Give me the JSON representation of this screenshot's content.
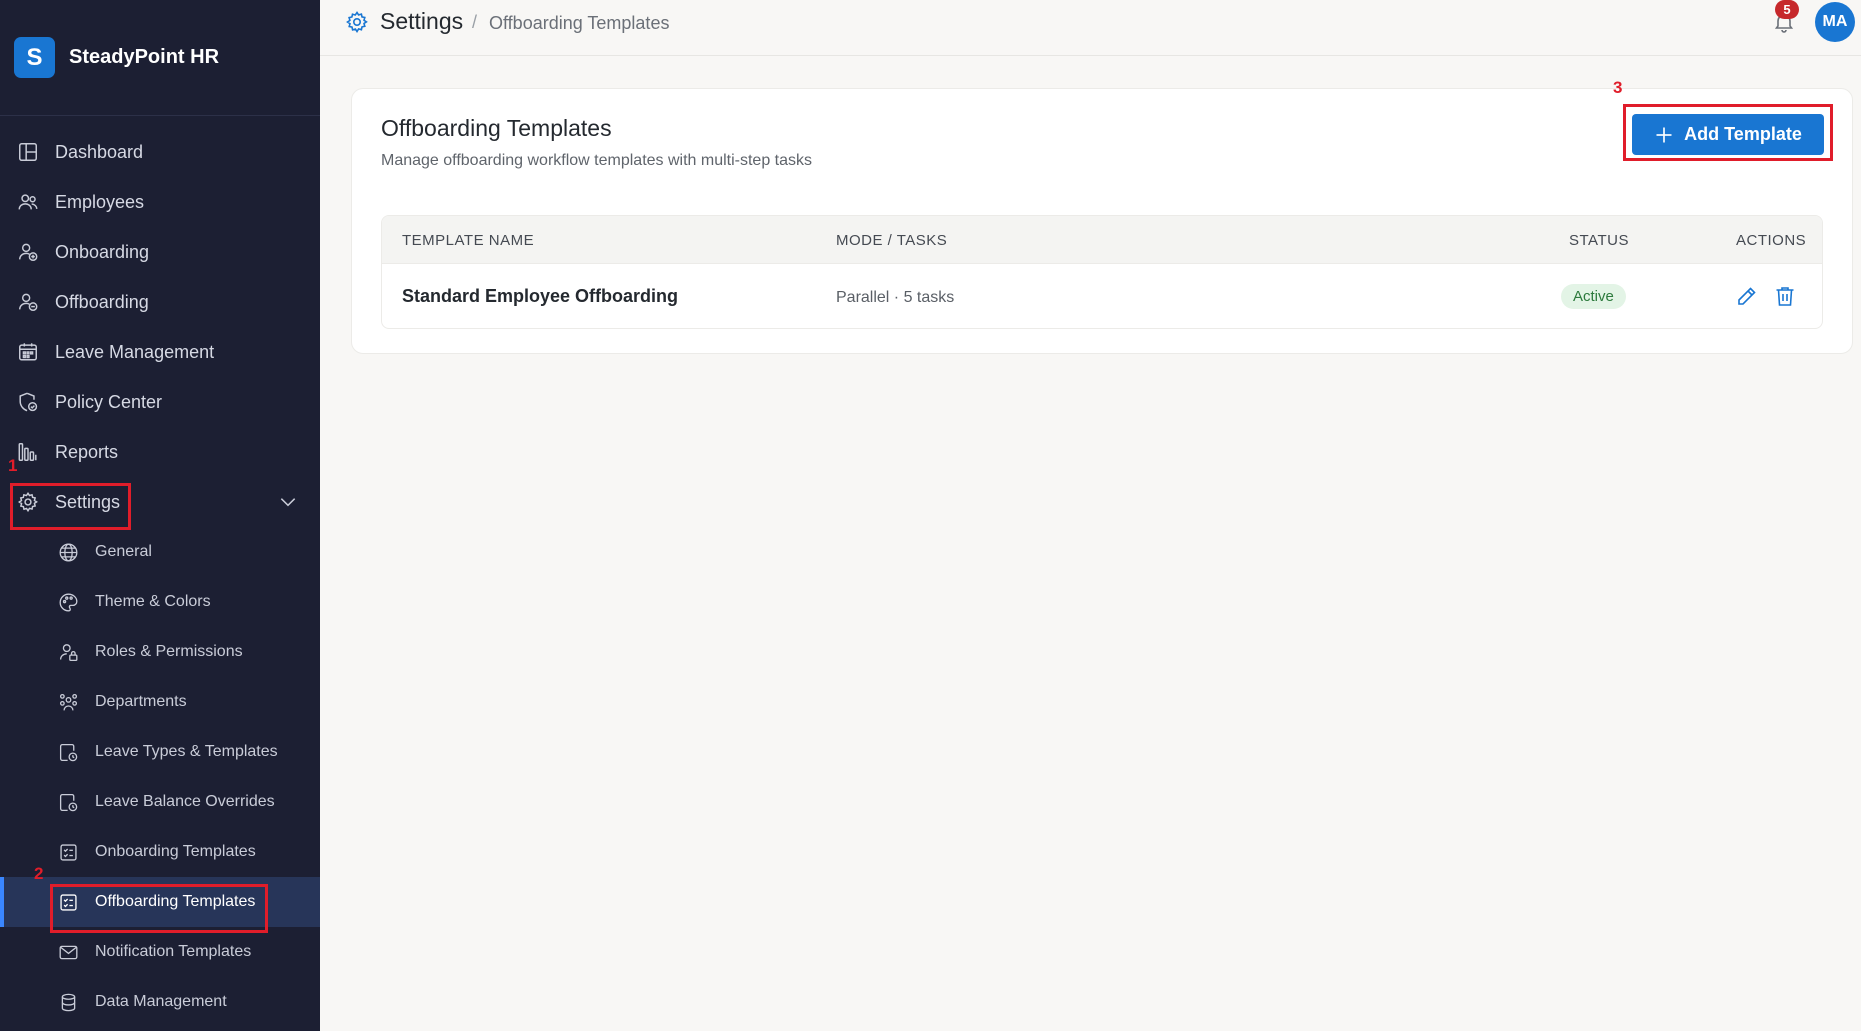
{
  "brand": {
    "logo_letter": "S",
    "name": "SteadyPoint HR"
  },
  "sidebar": {
    "items": [
      {
        "label": "Dashboard",
        "icon": "dashboard-icon"
      },
      {
        "label": "Employees",
        "icon": "users-icon"
      },
      {
        "label": "Onboarding",
        "icon": "user-plus-icon"
      },
      {
        "label": "Offboarding",
        "icon": "user-minus-icon"
      },
      {
        "label": "Leave Management",
        "icon": "calendar-icon"
      },
      {
        "label": "Policy Center",
        "icon": "shield-icon"
      },
      {
        "label": "Reports",
        "icon": "bar-chart-icon"
      },
      {
        "label": "Settings",
        "icon": "gear-icon",
        "expanded": true
      }
    ],
    "settings_subitems": [
      {
        "label": "General",
        "icon": "globe-icon"
      },
      {
        "label": "Theme & Colors",
        "icon": "palette-icon"
      },
      {
        "label": "Roles & Permissions",
        "icon": "user-lock-icon"
      },
      {
        "label": "Departments",
        "icon": "group-icon"
      },
      {
        "label": "Leave Types & Templates",
        "icon": "calendar-clock-icon"
      },
      {
        "label": "Leave Balance Overrides",
        "icon": "calendar-clock-icon"
      },
      {
        "label": "Onboarding Templates",
        "icon": "checklist-icon"
      },
      {
        "label": "Offboarding Templates",
        "icon": "checklist-icon",
        "active": true
      },
      {
        "label": "Notification Templates",
        "icon": "mail-icon"
      },
      {
        "label": "Data Management",
        "icon": "database-icon"
      }
    ]
  },
  "annotations": {
    "step1": "1",
    "step2": "2",
    "step3": "3",
    "color": "#e01d2a"
  },
  "header": {
    "breadcrumb_main": "Settings",
    "breadcrumb_sep": "/",
    "breadcrumb_sub": "Offboarding Templates",
    "notification_count": "5",
    "avatar_initials": "MA"
  },
  "main": {
    "title": "Offboarding Templates",
    "subtitle": "Manage offboarding workflow templates with multi-step tasks",
    "add_button_label": "Add Template",
    "table": {
      "columns": [
        "TEMPLATE NAME",
        "MODE / TASKS",
        "STATUS",
        "ACTIONS"
      ],
      "rows": [
        {
          "name": "Standard Employee Offboarding",
          "mode_tasks": "Parallel · 5 tasks",
          "status": "Active"
        }
      ]
    }
  },
  "colors": {
    "sidebar_bg": "#1c1f33",
    "accent": "#1976d2",
    "active_badge_bg": "#e3f4e6",
    "active_badge_text": "#2c7a3c"
  }
}
